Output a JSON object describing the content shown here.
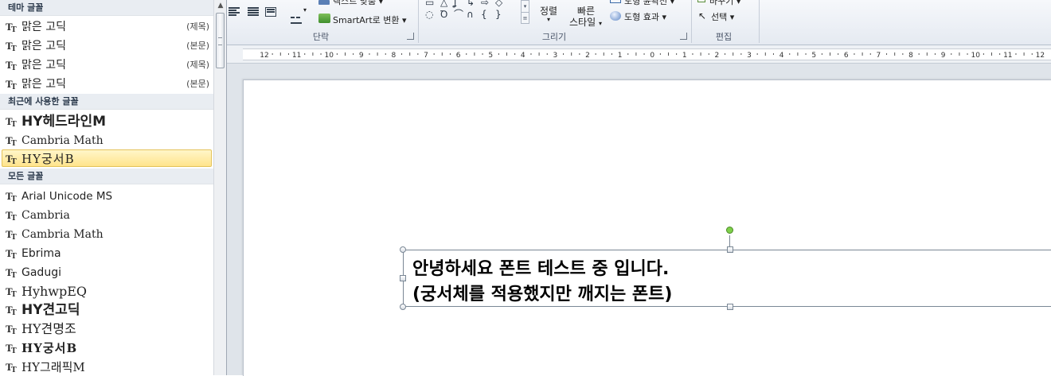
{
  "font_panel": {
    "sections": {
      "theme": "테마 글꼴",
      "recent": "최근에 사용한 글꼴",
      "all": "모든 글꼴"
    },
    "theme_fonts": [
      {
        "name": "맑은 고딕",
        "tag": "(제목)"
      },
      {
        "name": "맑은 고딕",
        "tag": "(본문)"
      },
      {
        "name": "맑은 고딕",
        "tag": "(제목)"
      },
      {
        "name": "맑은 고딕",
        "tag": "(본문)"
      }
    ],
    "recent_fonts": [
      {
        "name": "HY헤드라인M"
      },
      {
        "name": "Cambria Math"
      },
      {
        "name": "HY궁서B",
        "highlighted": true
      }
    ],
    "all_fonts": [
      {
        "name": "Arial Unicode MS"
      },
      {
        "name": "Cambria"
      },
      {
        "name": "Cambria Math"
      },
      {
        "name": "Ebrima"
      },
      {
        "name": "Gadugi"
      },
      {
        "name": "HyhwpEQ"
      },
      {
        "name": "HY견고딕"
      },
      {
        "name": "HY견명조"
      },
      {
        "name": "HY궁서B"
      },
      {
        "name": "HY그래픽M"
      }
    ],
    "font_icon": "truetype-font-icon"
  },
  "ribbon": {
    "groups": {
      "paragraph": "단락",
      "drawing": "그리기",
      "editing": "편집"
    },
    "text_align_partial": "텍스트 맞춤",
    "smartart_label": "SmartArt로 변환",
    "arrange_label": "정렬",
    "quick_styles_label_1": "빠른",
    "quick_styles_label_2": "스타일",
    "shape_fill_partial": "도형 윤곽선",
    "shape_effects_label": "도형 효과",
    "replace_partial": "바꾸기",
    "select_label": "선택"
  },
  "ruler": {
    "labels": [
      "12",
      "11",
      "10",
      "9",
      "8",
      "7",
      "6",
      "5",
      "4",
      "3",
      "2",
      "1",
      "0",
      "1",
      "2",
      "3",
      "4",
      "5",
      "6",
      "7",
      "8",
      "9",
      "10",
      "11",
      "12"
    ]
  },
  "slide": {
    "text_lines": [
      "안녕하세요 폰트 테스트 중 입니다.",
      "(궁서체를 적용했지만 깨지는 폰트)"
    ]
  },
  "colors": {
    "highlight": "#ffe48c",
    "rotate_handle": "#7ed04a",
    "ribbon_bg": "#e5eaf1"
  }
}
